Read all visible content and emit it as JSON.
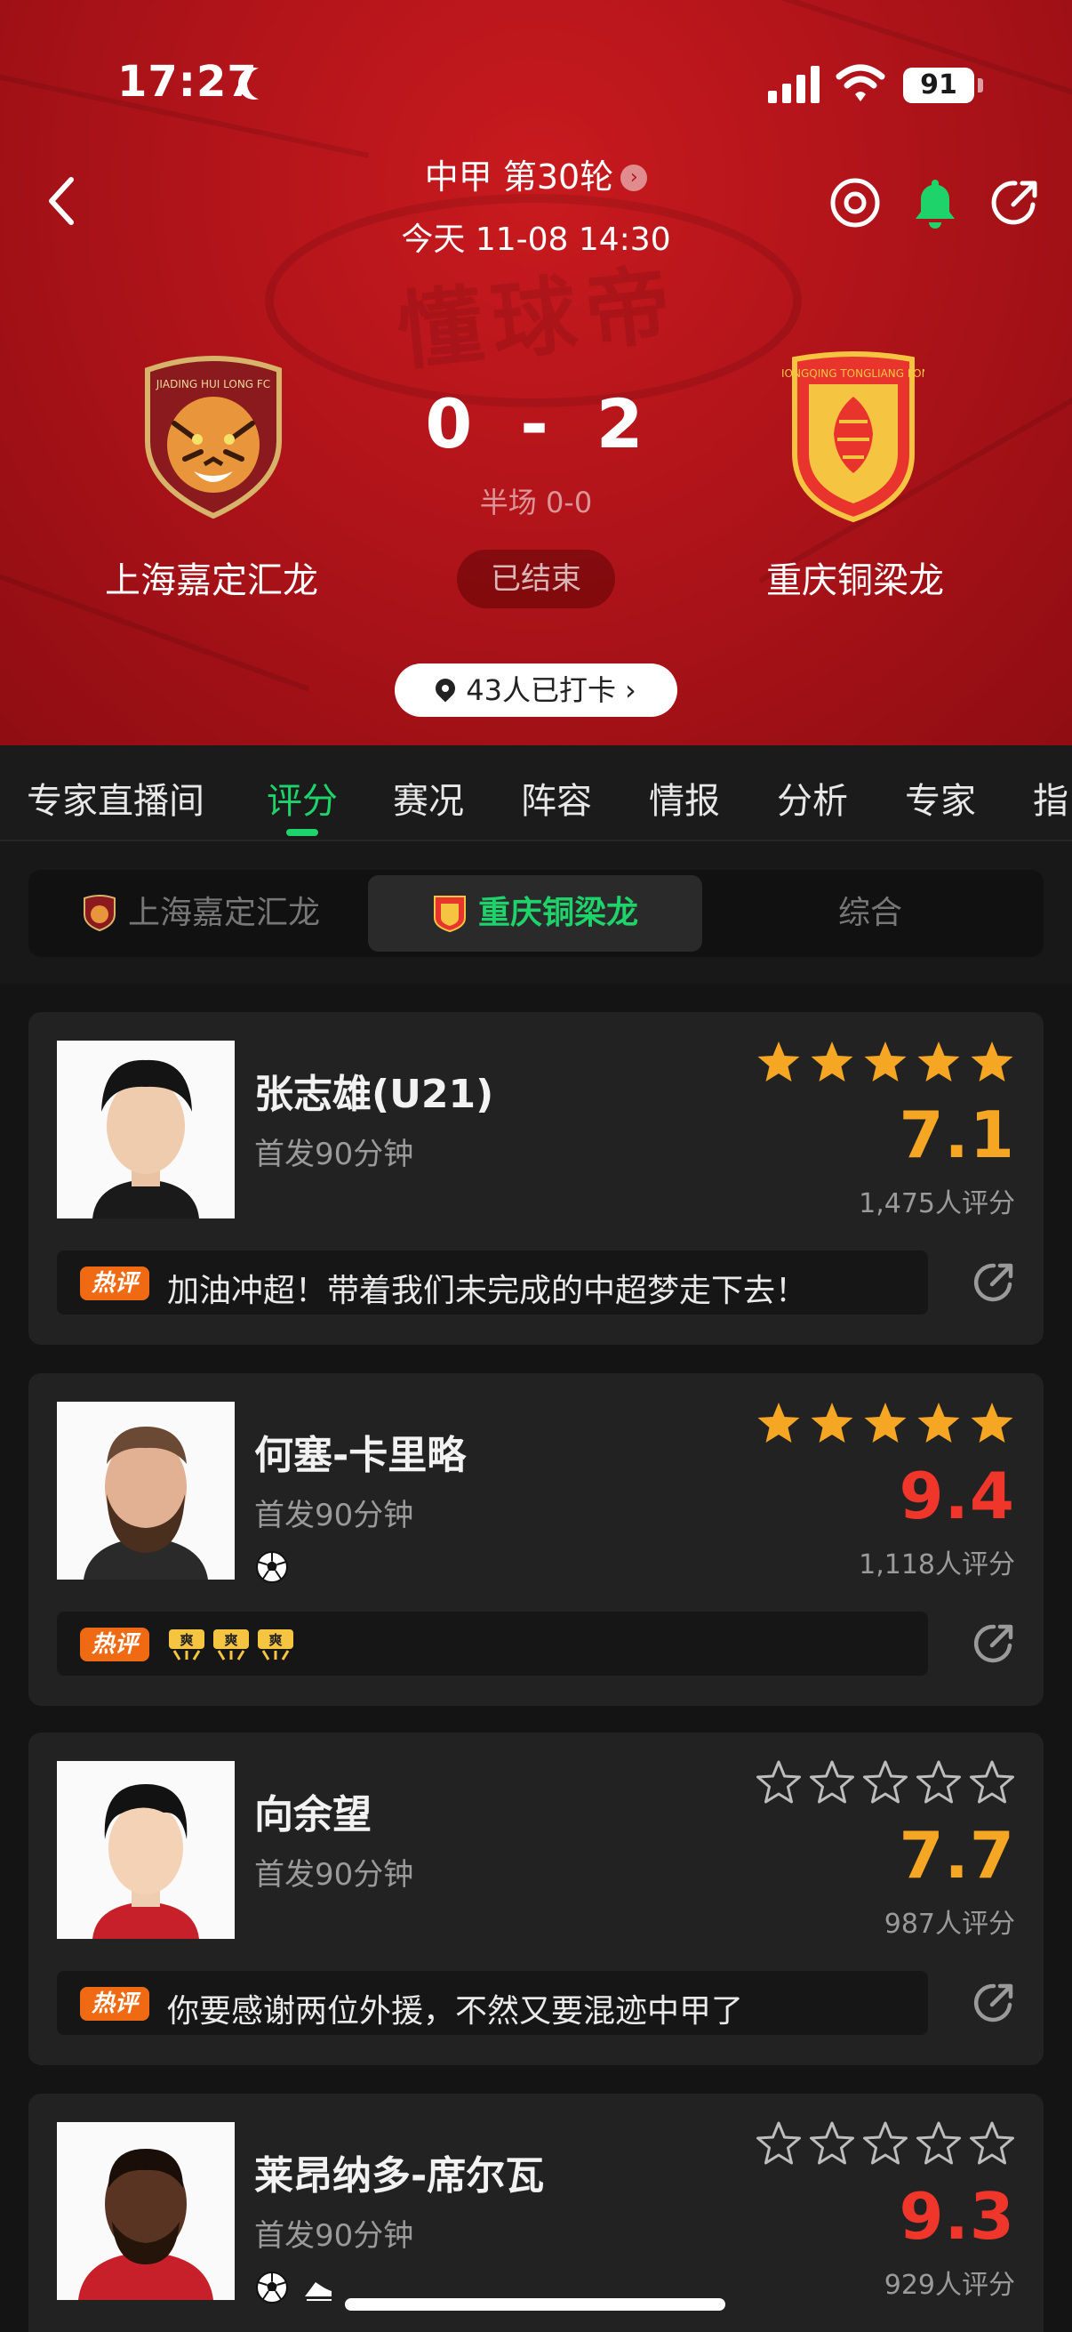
{
  "status_bar": {
    "time": "17:27",
    "battery": "91"
  },
  "header": {
    "league": "中甲 第30轮",
    "match_time": "今天 11-08 14:30",
    "watermark": "懂球帝",
    "home_team": {
      "name": "上海嘉定汇龙",
      "badge_text": "JIADING HUI LONG FC"
    },
    "away_team": {
      "name": "重庆铜梁龙",
      "badge_text": "CHONGQING TONGLIANG LONG"
    },
    "score_home": "0",
    "score_sep": "-",
    "score_away": "2",
    "half_time": "半场 0-0",
    "status": "已结束",
    "checkin": "43人已打卡"
  },
  "tabs": [
    {
      "label": "专家直播间"
    },
    {
      "label": "评分"
    },
    {
      "label": "赛况"
    },
    {
      "label": "阵容"
    },
    {
      "label": "情报"
    },
    {
      "label": "分析"
    },
    {
      "label": "专家"
    },
    {
      "label": "指"
    }
  ],
  "active_tab": "评分",
  "segments": [
    {
      "label": "上海嘉定汇龙"
    },
    {
      "label": "重庆铜梁龙"
    },
    {
      "label": "综合"
    }
  ],
  "active_segment": "重庆铜梁龙",
  "players": [
    {
      "name": "张志雄(U21)",
      "start_info": "首发90分钟",
      "rating": "7.1",
      "rating_color": "#f5a623",
      "rating_count": "1,475人评分",
      "stars_filled": 5,
      "hot_label": "热评",
      "comment": "加油冲超！带着我们未完成的中超梦走下去！",
      "events": []
    },
    {
      "name": "何塞-卡里略",
      "start_info": "首发90分钟",
      "rating": "9.4",
      "rating_color": "#f0352a",
      "rating_count": "1,118人评分",
      "stars_filled": 5,
      "hot_label": "热评",
      "comment": "",
      "comment_emojis": [
        "爽",
        "爽",
        "爽"
      ],
      "events": [
        "goal-icon"
      ]
    },
    {
      "name": "向余望",
      "start_info": "首发90分钟",
      "rating": "7.7",
      "rating_color": "#f5a623",
      "rating_count": "987人评分",
      "stars_filled": 0,
      "hot_label": "热评",
      "comment": "你要感谢两位外援，不然又要混迹中甲了",
      "events": []
    },
    {
      "name": "莱昂纳多-席尔瓦",
      "start_info": "首发90分钟",
      "rating": "9.3",
      "rating_color": "#f0352a",
      "rating_count": "929人评分",
      "stars_filled": 0,
      "events": [
        "goal-icon",
        "assist-boot-icon"
      ]
    }
  ],
  "colors": {
    "accent": "#1fd36b",
    "header_red": "#b0141a",
    "star": "#f5a623"
  }
}
